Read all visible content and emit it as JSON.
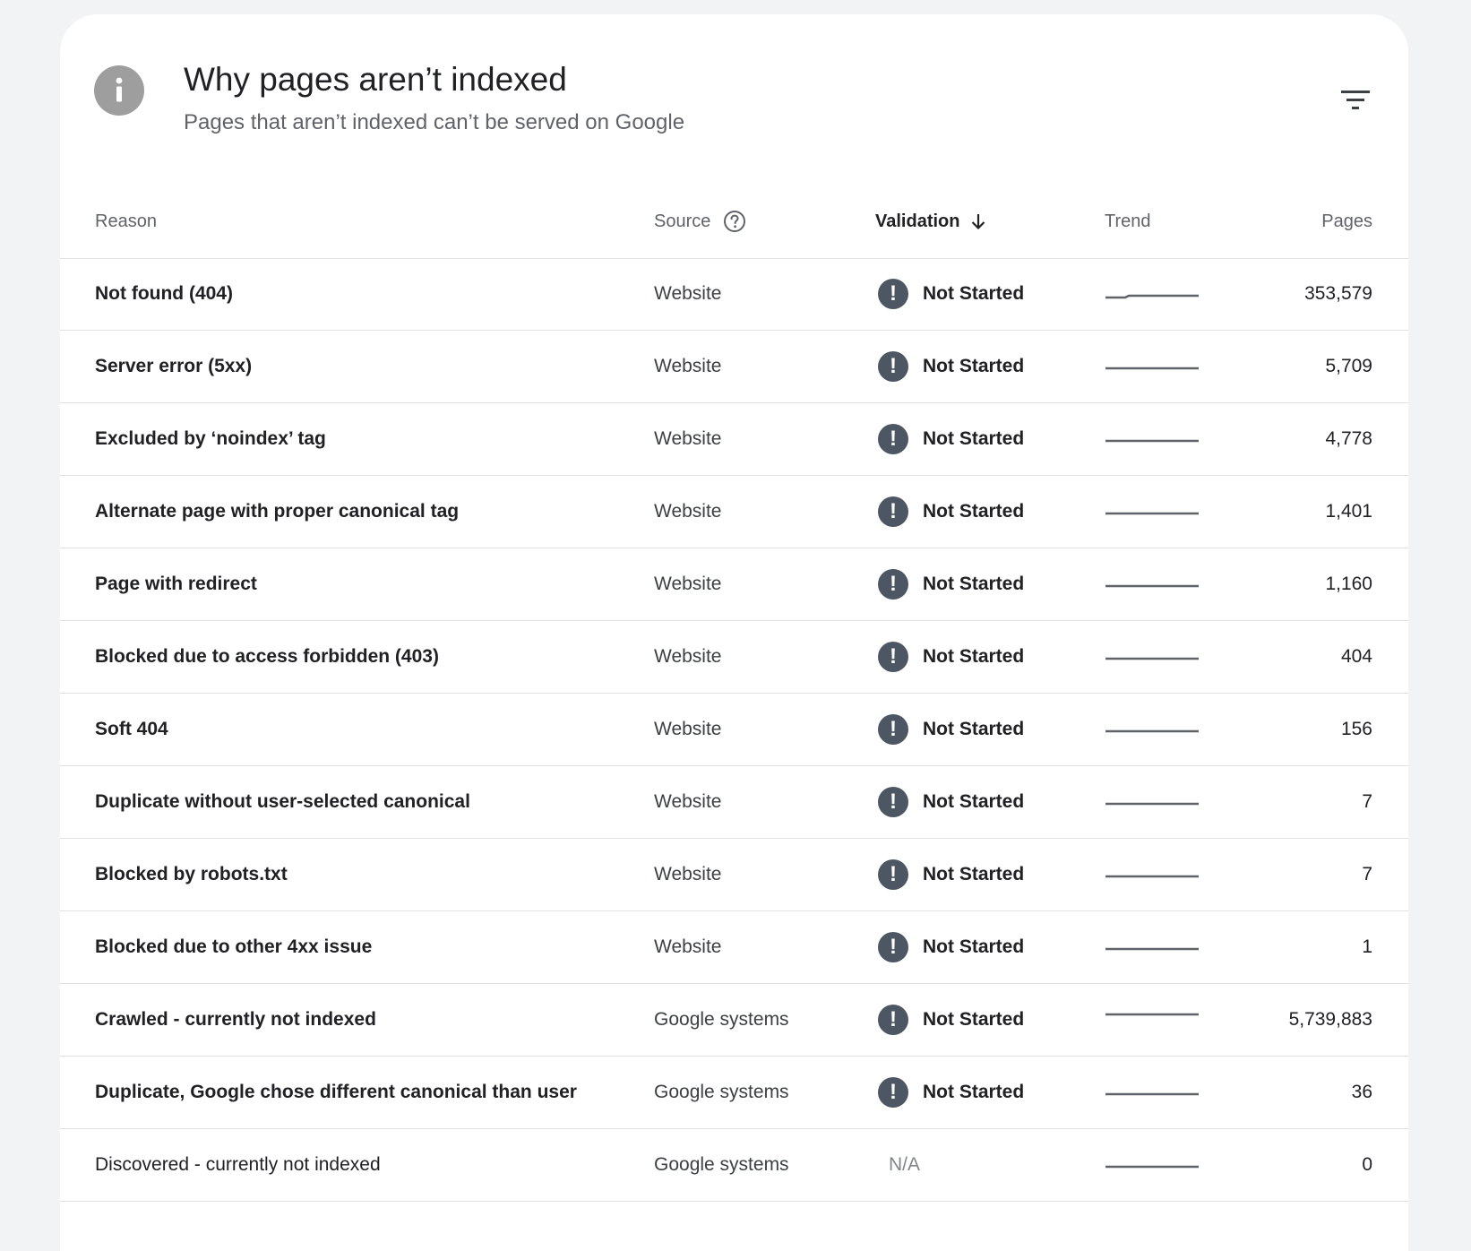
{
  "header": {
    "title": "Why pages aren’t indexed",
    "subtitle": "Pages that aren’t indexed can’t be served on Google",
    "info_icon": "info-icon",
    "filter_icon": "filter-icon"
  },
  "columns": {
    "reason": "Reason",
    "source": "Source",
    "validation": "Validation",
    "trend": "Trend",
    "pages": "Pages"
  },
  "colors": {
    "status_icon": "#4d5763",
    "sparkline": "#5f6368",
    "divider": "#e0e0e0"
  },
  "rows": [
    {
      "reason": "Not found (404)",
      "source": "Website",
      "validation": "Not Started",
      "pages": "353,579",
      "trend": "rising-slightly"
    },
    {
      "reason": "Server error (5xx)",
      "source": "Website",
      "validation": "Not Started",
      "pages": "5,709",
      "trend": "flat"
    },
    {
      "reason": "Excluded by ‘noindex’ tag",
      "source": "Website",
      "validation": "Not Started",
      "pages": "4,778",
      "trend": "flat"
    },
    {
      "reason": "Alternate page with proper canonical tag",
      "source": "Website",
      "validation": "Not Started",
      "pages": "1,401",
      "trend": "flat"
    },
    {
      "reason": "Page with redirect",
      "source": "Website",
      "validation": "Not Started",
      "pages": "1,160",
      "trend": "flat"
    },
    {
      "reason": "Blocked due to access forbidden (403)",
      "source": "Website",
      "validation": "Not Started",
      "pages": "404",
      "trend": "flat"
    },
    {
      "reason": "Soft 404",
      "source": "Website",
      "validation": "Not Started",
      "pages": "156",
      "trend": "flat"
    },
    {
      "reason": "Duplicate without user-selected canonical",
      "source": "Website",
      "validation": "Not Started",
      "pages": "7",
      "trend": "flat"
    },
    {
      "reason": "Blocked by robots.txt",
      "source": "Website",
      "validation": "Not Started",
      "pages": "7",
      "trend": "flat"
    },
    {
      "reason": "Blocked due to other 4xx issue",
      "source": "Website",
      "validation": "Not Started",
      "pages": "1",
      "trend": "flat"
    },
    {
      "reason": "Crawled - currently not indexed",
      "source": "Google systems",
      "validation": "Not Started",
      "pages": "5,739,883",
      "trend": "flat-high"
    },
    {
      "reason": "Duplicate, Google chose different canonical than user",
      "source": "Google systems",
      "validation": "Not Started",
      "pages": "36",
      "trend": "flat"
    },
    {
      "reason": "Discovered - currently not indexed",
      "source": "Google systems",
      "validation": "N/A",
      "pages": "0",
      "trend": "flat"
    }
  ]
}
